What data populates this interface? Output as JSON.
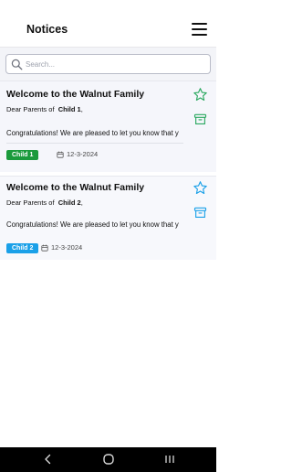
{
  "header": {
    "title": "Notices",
    "menu_icon": "hamburger-menu-icon"
  },
  "search": {
    "placeholder": "Search...",
    "value": "",
    "icon": "search-icon"
  },
  "notices": [
    {
      "title": "Welcome to the Walnut Family",
      "greeting_prefix": "Dear Parents of",
      "child_name": "Child 1",
      "greeting_suffix": ",",
      "body": "Congratulations! We are pleased to let you know that y",
      "badge": "Child 1",
      "badge_color": "#1b9a3c",
      "date": "12-3-2024",
      "star_color": "#2aa85f",
      "archive_color": "#2aa85f"
    },
    {
      "title": "Welcome to the Walnut Family",
      "greeting_prefix": "Dear Parents of",
      "child_name": "Child 2",
      "greeting_suffix": ",",
      "body": "Congratulations! We are pleased to let you know that y",
      "badge": "Child 2",
      "badge_color": "#1aa0e8",
      "date": "12-3-2024",
      "star_color": "#1aa0e8",
      "archive_color": "#1aa0e8"
    }
  ],
  "navigation": {
    "back_icon": "back-chevron-icon",
    "home_icon": "home-circle-icon",
    "recents_icon": "recents-icon"
  }
}
